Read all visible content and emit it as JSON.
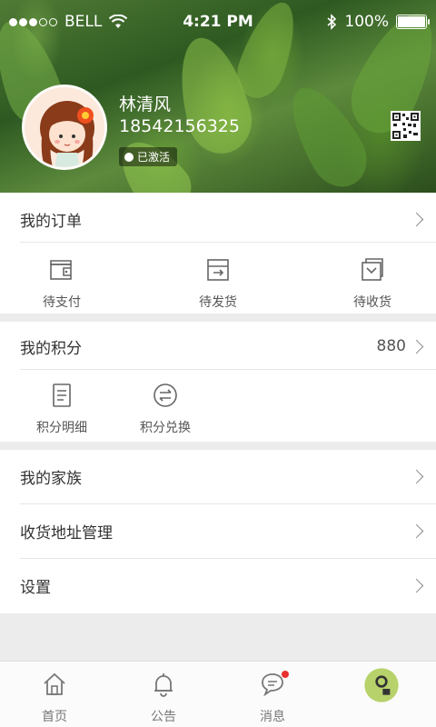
{
  "status_bar": {
    "carrier": "BELL",
    "time": "4:21 PM",
    "battery": "100%"
  },
  "profile": {
    "name": "林清风",
    "phone": "18542156325",
    "status": "已激活"
  },
  "orders": {
    "title": "我的订单",
    "items": [
      {
        "label": "待支付",
        "icon": "wallet-icon"
      },
      {
        "label": "待发货",
        "icon": "shipping-box-icon"
      },
      {
        "label": "待收货",
        "icon": "receive-box-icon"
      }
    ]
  },
  "points": {
    "title": "我的积分",
    "value": "880",
    "items": [
      {
        "label": "积分明细",
        "icon": "document-icon"
      },
      {
        "label": "积分兑换",
        "icon": "exchange-icon"
      }
    ]
  },
  "menu": [
    {
      "label": "我的家族"
    },
    {
      "label": "收货地址管理"
    },
    {
      "label": "设置"
    }
  ],
  "tabs": [
    {
      "label": "首页",
      "icon": "home-icon"
    },
    {
      "label": "公告",
      "icon": "bell-icon"
    },
    {
      "label": "消息",
      "icon": "message-icon"
    },
    {
      "label": "",
      "icon": "profile-icon"
    }
  ],
  "colors": {
    "accent": "#4a7a2e",
    "badge": "#e8312e",
    "background": "#ececec"
  }
}
